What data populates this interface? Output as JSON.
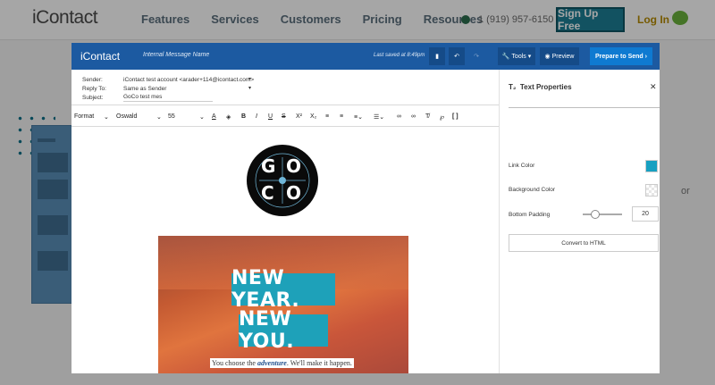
{
  "site": {
    "logo": "iContact",
    "nav": [
      "Features",
      "Services",
      "Customers",
      "Pricing",
      "Resources"
    ],
    "phone": "1 (919) 957-6150",
    "signup": "Sign Up Free",
    "login": "Log In",
    "side_text": "or"
  },
  "editor": {
    "logo": "iContact",
    "message_name": "Internal Message Name",
    "last_saved": "Last saved at 8:49pm",
    "tools_label": "Tools",
    "preview_label": "Preview",
    "send_label": "Prepare to Send",
    "sender_label": "Sender:",
    "sender_value": "iContact test account <arader+114@icontact.com>",
    "reply_label": "Reply To:",
    "reply_value": "Same as Sender",
    "subject_label": "Subject:",
    "subject_value": "GoCo test mes",
    "toolbar": {
      "format": "Format",
      "font": "Oswald",
      "size": "55"
    },
    "content": {
      "logo_letters": [
        "G",
        "O",
        "C",
        "O"
      ],
      "hero_line1": "NEW YEAR.",
      "hero_line2": "NEW YOU.",
      "tagline_pre": "You choose the ",
      "tagline_em": "adventure",
      "tagline_post": ". We'll make it happen."
    },
    "panel": {
      "title": "Text Properties",
      "link_color_label": "Link Color",
      "link_color": "#17a0c1",
      "bg_color_label": "Background Color",
      "padding_label": "Bottom Padding",
      "padding_value": "20",
      "convert_label": "Convert to HTML"
    }
  },
  "colors": {
    "topbar": "#1c5aa1",
    "send_button": "#0f7ad1",
    "accent": "#1ea1b9"
  }
}
